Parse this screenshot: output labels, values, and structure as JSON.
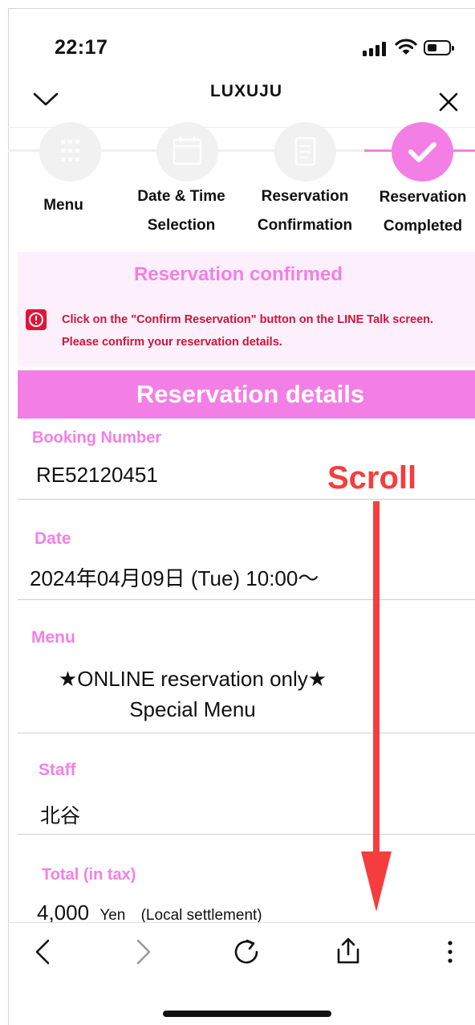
{
  "status_bar": {
    "time": "22:17"
  },
  "header": {
    "title": "LUXUJU"
  },
  "steps": [
    {
      "label_line1": "Menu",
      "label_line2": ""
    },
    {
      "label_line1": "Date & Time",
      "label_line2": "Selection"
    },
    {
      "label_line1": "Reservation",
      "label_line2": "Confirmation"
    },
    {
      "label_line1": "Reservation",
      "label_line2": "Completed"
    }
  ],
  "notice": {
    "title": "Reservation confirmed",
    "line1": "Click on the \"Confirm Reservation\" button on the LINE Talk screen.",
    "line2": "Please confirm your reservation details."
  },
  "details": {
    "heading": "Reservation details",
    "booking_label": "Booking Number",
    "booking_value": "RE52120451",
    "date_label": "Date",
    "date_value": "2024年04月09日 (Tue) 10:00～",
    "menu_label": "Menu",
    "menu_value_line1": "★ONLINE reservation only★",
    "menu_value_line2": "Special Menu",
    "staff_label": "Staff",
    "staff_value": "北谷",
    "total_label": "Total (in tax)",
    "total_amount": "4,000",
    "total_currency": "Yen",
    "total_note": "(Local settlement)"
  },
  "annotation": {
    "text": "Scroll",
    "color": "#f53d3d"
  },
  "colors": {
    "accent": "#f37fe6",
    "notice_bg": "#fdeffb",
    "error": "#d0143a"
  }
}
